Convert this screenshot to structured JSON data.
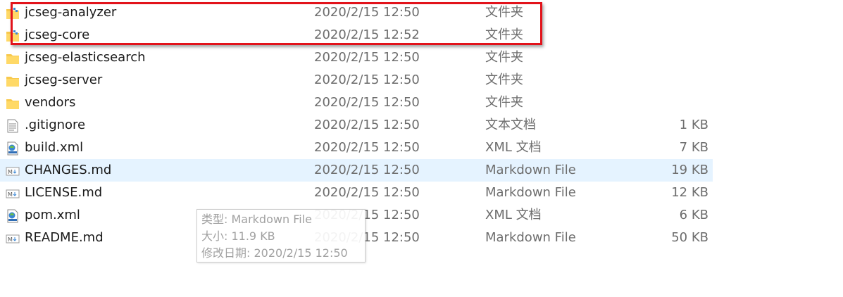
{
  "files": [
    {
      "name": "jcseg-analyzer",
      "date": "2020/2/15 12:50",
      "type": "文件夹",
      "size": "",
      "icon": "folder-icon"
    },
    {
      "name": "jcseg-core",
      "date": "2020/2/15 12:52",
      "type": "文件夹",
      "size": "",
      "icon": "folder-icon"
    },
    {
      "name": "jcseg-elasticsearch",
      "date": "2020/2/15 12:50",
      "type": "文件夹",
      "size": "",
      "icon": "folder-icon"
    },
    {
      "name": "jcseg-server",
      "date": "2020/2/15 12:50",
      "type": "文件夹",
      "size": "",
      "icon": "folder-icon"
    },
    {
      "name": "vendors",
      "date": "2020/2/15 12:50",
      "type": "文件夹",
      "size": "",
      "icon": "folder-icon"
    },
    {
      "name": ".gitignore",
      "date": "2020/2/15 12:50",
      "type": "文本文档",
      "size": "1 KB",
      "icon": "text-file-icon"
    },
    {
      "name": "build.xml",
      "date": "2020/2/15 12:50",
      "type": "XML 文档",
      "size": "7 KB",
      "icon": "xml-file-icon"
    },
    {
      "name": "CHANGES.md",
      "date": "2020/2/15 12:50",
      "type": "Markdown File",
      "size": "19 KB",
      "icon": "markdown-file-icon"
    },
    {
      "name": "LICENSE.md",
      "date": "2020/2/15 12:50",
      "type": "Markdown File",
      "size": "12 KB",
      "icon": "markdown-file-icon"
    },
    {
      "name": "pom.xml",
      "date": "2020/2/15 12:50",
      "type": "XML 文档",
      "size": "6 KB",
      "icon": "xml-file-icon"
    },
    {
      "name": "README.md",
      "date": "2020/2/15 12:50",
      "type": "Markdown File",
      "size": "50 KB",
      "icon": "markdown-file-icon"
    }
  ],
  "tooltip": {
    "type_line": "类型: Markdown File",
    "size_line": "大小: 11.9 KB",
    "modified_line": "修改日期: 2020/2/15 12:50"
  },
  "colors": {
    "highlight_border": "#e2131b",
    "hover_row": "#e5f3ff",
    "folder": "#f8c94d"
  }
}
